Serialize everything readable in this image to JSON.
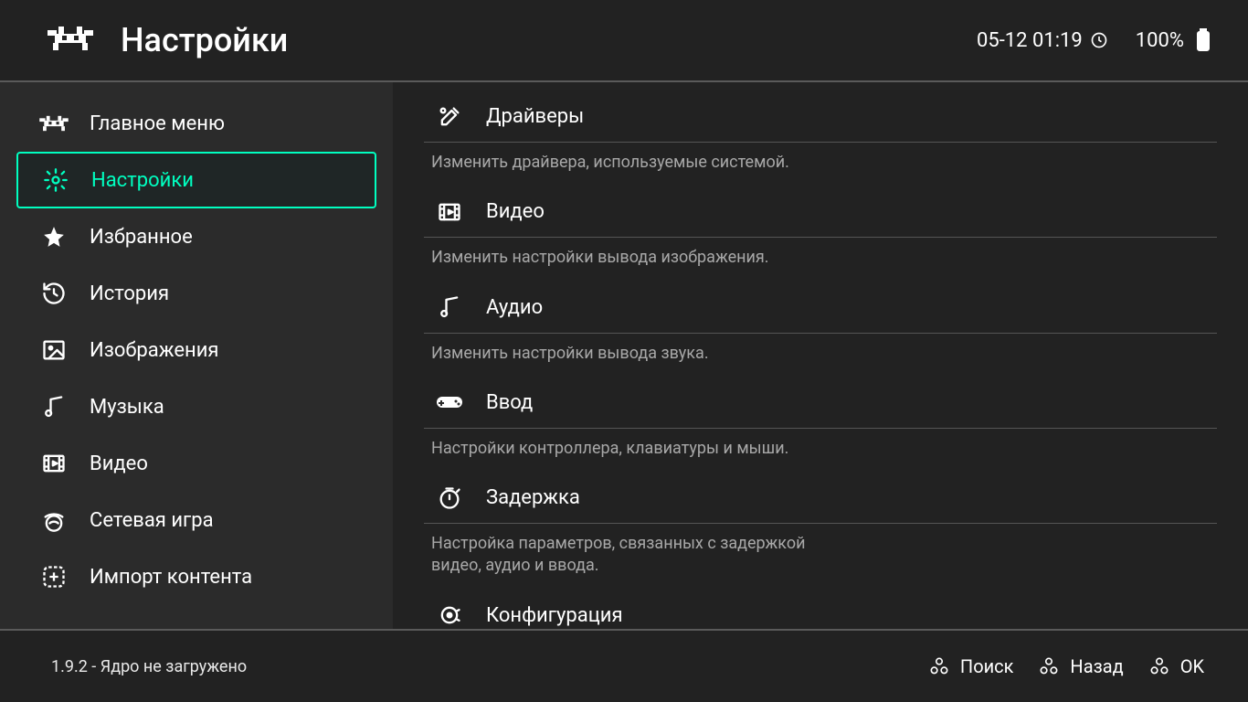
{
  "header": {
    "title": "Настройки",
    "datetime": "05-12 01:19",
    "battery": "100%"
  },
  "sidebar": {
    "items": [
      {
        "label": "Главное меню",
        "icon": "retroarch"
      },
      {
        "label": "Настройки",
        "icon": "gear",
        "active": true
      },
      {
        "label": "Избранное",
        "icon": "star"
      },
      {
        "label": "История",
        "icon": "history"
      },
      {
        "label": "Изображения",
        "icon": "image"
      },
      {
        "label": "Музыка",
        "icon": "music"
      },
      {
        "label": "Видео",
        "icon": "video"
      },
      {
        "label": "Сетевая игра",
        "icon": "netplay"
      },
      {
        "label": "Импорт контента",
        "icon": "import"
      }
    ]
  },
  "main": {
    "items": [
      {
        "label": "Драйверы",
        "desc": "Изменить драйвера, используемые системой.",
        "icon": "tools"
      },
      {
        "label": "Видео",
        "desc": "Изменить настройки вывода изображения.",
        "icon": "video"
      },
      {
        "label": "Аудио",
        "desc": "Изменить настройки вывода звука.",
        "icon": "audio"
      },
      {
        "label": "Ввод",
        "desc": "Настройки контроллера, клавиатуры и мыши.",
        "icon": "gamepad"
      },
      {
        "label": "Задержка",
        "desc": "Настройка параметров, связанных с задержкой видео, аудио и ввода.",
        "icon": "latency"
      },
      {
        "label": "Конфигурация",
        "desc": "",
        "icon": "config"
      }
    ]
  },
  "footer": {
    "status": "1.9.2 - Ядро не загружено",
    "hints": [
      {
        "label": "Поиск"
      },
      {
        "label": "Назад"
      },
      {
        "label": "OK"
      }
    ]
  }
}
